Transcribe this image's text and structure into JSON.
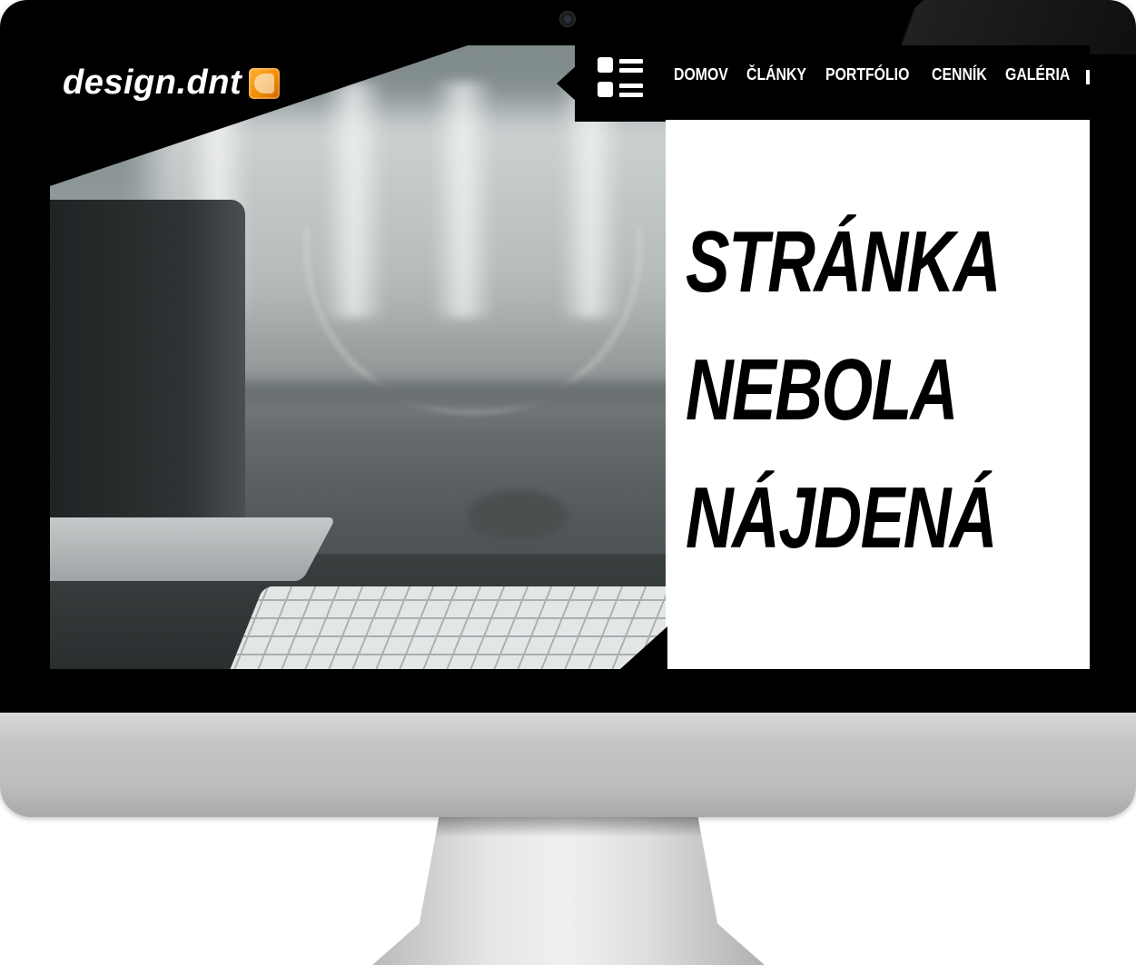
{
  "site": {
    "logo_text": "design.dnt",
    "logo_icon": "d-logo-icon"
  },
  "nav": {
    "menu_icon": "grid-list-icon",
    "items": [
      {
        "label": "DOMOV"
      },
      {
        "label": "ČLÁNKY"
      },
      {
        "label": "PORTFÓLIO"
      },
      {
        "label": "CENNÍK"
      },
      {
        "label": "GALÉRIA"
      }
    ]
  },
  "error": {
    "line1": "STRÁNKA",
    "line2": "NEBOLA",
    "line3": "NÁJDENÁ"
  },
  "colors": {
    "nav_bg": "#000000",
    "panel_bg": "#ffffff",
    "logo_accent": "#f08a00"
  }
}
